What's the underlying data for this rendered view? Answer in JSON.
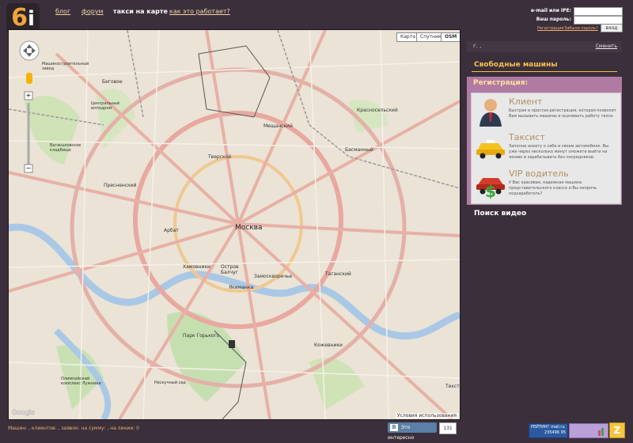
{
  "logo": {
    "text": "6",
    "accent": "i"
  },
  "nav": [
    {
      "label": "блог"
    },
    {
      "label": "форум"
    },
    {
      "label": "такси на карте",
      "active": true
    },
    {
      "label": "как это работает?"
    }
  ],
  "login": {
    "email_label": "e-mail или IPE:",
    "password_label": "Ваш пароль:",
    "register_link": "Регистрация",
    "forgot_link": "Забыли пароль?",
    "submit_label": "вход"
  },
  "map": {
    "type_buttons": [
      "Карта",
      "Спутник",
      "OSM"
    ],
    "center_label": "Москва",
    "districts": [
      "Беговое",
      "Тверской",
      "Мещанский",
      "Красносельский",
      "Басманный",
      "Пресненский",
      "Арбат",
      "Хамовники",
      "Якиманка",
      "Замоскворечье",
      "Таганский",
      "Кожевники",
      "Остров Балчуг",
      "Парк Горького",
      "Текст"
    ],
    "landmarks": [
      "Машиностроительный завод",
      "Центральный ипподром",
      "Ваганьковское кладбище",
      "Олимпийский комплекс Лужники",
      "Нескучный сад"
    ],
    "attribution": "Условия использования",
    "google_label": "Google",
    "zoom_in": "+",
    "zoom_out": "−"
  },
  "sidebar": {
    "city_text": "г. ,",
    "change_link": "Сменить",
    "free_cars_heading": "Свободные машины",
    "registration_title": "Регистрация:",
    "roles": [
      {
        "title": "Клиент",
        "icon": "person-icon",
        "text": "Быстрая и простая регистрация, которая позволит Вам вызывать машины и оценивать работу такси."
      },
      {
        "title": "Таксист",
        "icon": "taxi-car-icon",
        "text": "Заполни анкету о себе и своем автомобиле. Вы уже через несколько минут сможете выйти на линию и зарабатывать без посредников."
      },
      {
        "title": "VIP водитель",
        "icon": "dollar-car-icon",
        "text": "У Вас красивая, надежная машина представительского класса и Вы непрочь подзаработать?"
      }
    ],
    "video_search": "Поиск видео"
  },
  "footer": {
    "stats": "Машин: , клиентов: , заявок: на сумму: , на линии: 0",
    "vk_label": "Это интересно",
    "vk_count": "131",
    "mail_counter_label": "РЕЙТИНГ mail.ru",
    "mail_counter_values": "235496 95",
    "counter3_label": "Z"
  },
  "colors": {
    "background": "#3b2f3b",
    "accent": "#f5c050",
    "registration_bg": "#b07ba2",
    "vk_blue": "#5b7fa6"
  }
}
